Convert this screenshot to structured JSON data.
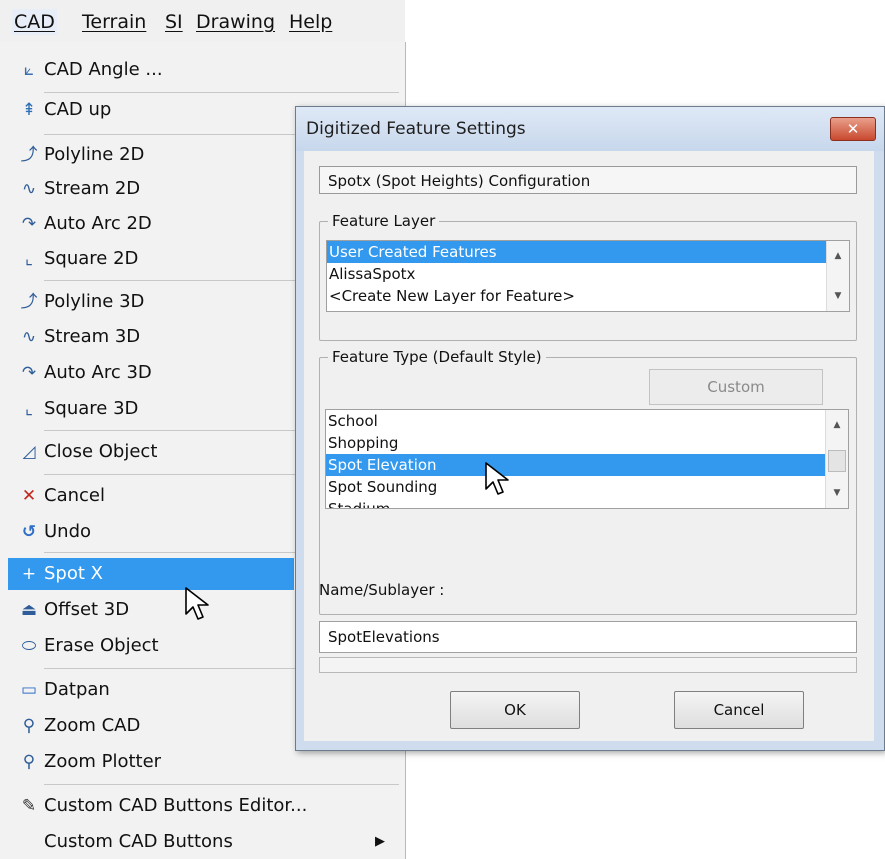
{
  "menubar": {
    "items": [
      {
        "label": "CAD"
      },
      {
        "label": "Terrain"
      },
      {
        "label": "SI"
      },
      {
        "label": "Drawing"
      },
      {
        "label": "Help"
      }
    ]
  },
  "menu": {
    "items": [
      {
        "label": "CAD Angle ...",
        "icon": "angle-icon"
      },
      {
        "label": "CAD up",
        "icon": "cad-up-icon"
      },
      {
        "label": "Polyline 2D",
        "icon": "polyline-2d-icon"
      },
      {
        "label": "Stream 2D",
        "icon": "stream-2d-icon"
      },
      {
        "label": "Auto Arc 2D",
        "icon": "auto-arc-2d-icon"
      },
      {
        "label": "Square 2D",
        "icon": "square-2d-icon"
      },
      {
        "label": "Polyline 3D",
        "icon": "polyline-3d-icon"
      },
      {
        "label": "Stream 3D",
        "icon": "stream-3d-icon"
      },
      {
        "label": "Auto Arc 3D",
        "icon": "auto-arc-3d-icon"
      },
      {
        "label": "Square 3D",
        "icon": "square-3d-icon"
      },
      {
        "label": "Close Object",
        "icon": "close-object-icon"
      },
      {
        "label": "Cancel",
        "icon": "cancel-icon"
      },
      {
        "label": "Undo",
        "icon": "undo-icon"
      },
      {
        "label": "Spot X",
        "icon": "spot-x-icon"
      },
      {
        "label": "Offset 3D",
        "icon": "offset-3d-icon"
      },
      {
        "label": "Erase Object",
        "icon": "erase-icon"
      },
      {
        "label": "Datpan",
        "icon": "datpan-icon"
      },
      {
        "label": "Zoom CAD",
        "icon": "zoom-cad-icon"
      },
      {
        "label": "Zoom Plotter",
        "icon": "zoom-plotter-icon"
      },
      {
        "label": "Custom CAD Buttons Editor...",
        "icon": "custom-editor-icon"
      },
      {
        "label": "Custom CAD Buttons",
        "icon": ""
      }
    ],
    "highlighted": "Spot X"
  },
  "dialog": {
    "title": "Digitized Feature Settings",
    "close_label": "✕",
    "config_text": "Spotx (Spot Heights) Configuration",
    "layer_group_label": "Feature Layer",
    "layers": [
      "User Created Features",
      "AlissaSpotx",
      "<Create New Layer for Feature>"
    ],
    "selected_layer": "User Created Features",
    "type_group_label": "Feature Type (Default Style)",
    "custom_label": "Custom",
    "types": [
      "School",
      "Shopping",
      "Spot Elevation",
      "Spot Sounding",
      "Stadium"
    ],
    "selected_type": "Spot Elevation",
    "name_label": "Name/Sublayer :",
    "name_value": "SpotElevations",
    "ok_label": "OK",
    "cancel_label": "Cancel"
  },
  "colors": {
    "selection": "#3399ee",
    "menu_bg": "#f2f2f2",
    "dialog_frame": "#cfdced",
    "close_button": "#c8492f"
  }
}
